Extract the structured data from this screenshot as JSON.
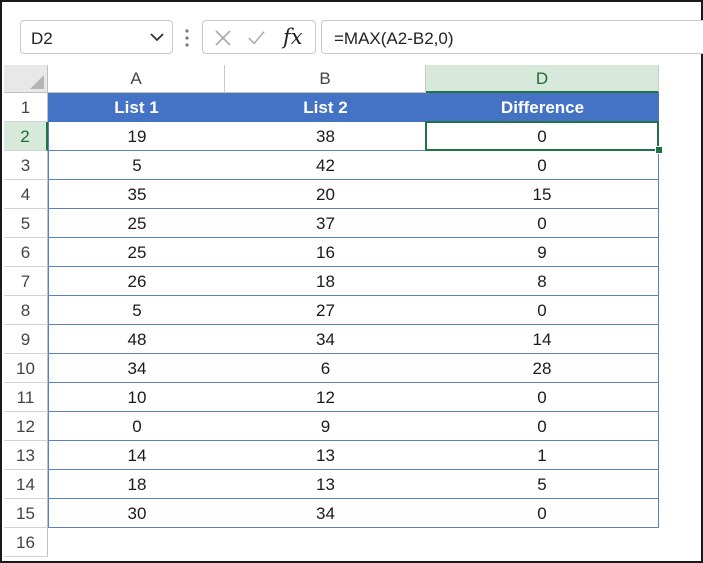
{
  "name_box": {
    "value": "D2"
  },
  "formula_bar": {
    "fx_label": "fx",
    "formula": "=MAX(A2-B2,0)"
  },
  "columns": [
    "A",
    "B",
    "D"
  ],
  "row_numbers": [
    "1",
    "2",
    "3",
    "4",
    "5",
    "6",
    "7",
    "8",
    "9",
    "10",
    "11",
    "12",
    "13",
    "14",
    "15",
    "16"
  ],
  "table": {
    "headers": [
      "List 1",
      "List 2",
      "Difference"
    ],
    "rows": [
      [
        "19",
        "38",
        "0"
      ],
      [
        "5",
        "42",
        "0"
      ],
      [
        "35",
        "20",
        "15"
      ],
      [
        "25",
        "37",
        "0"
      ],
      [
        "25",
        "16",
        "9"
      ],
      [
        "26",
        "18",
        "8"
      ],
      [
        "5",
        "27",
        "0"
      ],
      [
        "48",
        "34",
        "14"
      ],
      [
        "34",
        "6",
        "28"
      ],
      [
        "10",
        "12",
        "0"
      ],
      [
        "0",
        "9",
        "0"
      ],
      [
        "14",
        "13",
        "1"
      ],
      [
        "18",
        "13",
        "5"
      ],
      [
        "30",
        "34",
        "0"
      ]
    ]
  },
  "selection": {
    "cell": "D2",
    "column": "D",
    "row": "2"
  },
  "colors": {
    "header_fill": "#4472c4",
    "header_text": "#ffffff",
    "selection_green": "#217346",
    "table_border": "#5b7fbf"
  }
}
